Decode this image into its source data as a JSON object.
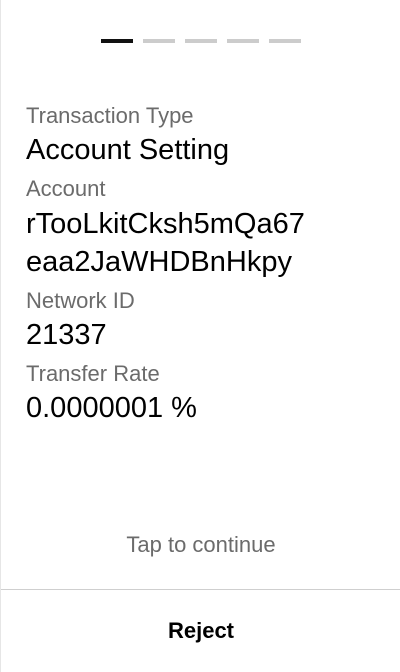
{
  "pager": {
    "total": 5,
    "current": 1
  },
  "fields": [
    {
      "label": "Transaction Type",
      "value": "Account Setting"
    },
    {
      "label": "Account",
      "value_lines": [
        "rTooLkitCksh5mQa67",
        "eaa2JaWHDBnHkpy"
      ]
    },
    {
      "label": "Network ID",
      "value": "21337"
    },
    {
      "label": "Transfer Rate",
      "value": "0.0000001 %"
    }
  ],
  "footer": {
    "hint": "Tap to continue",
    "reject_label": "Reject"
  },
  "colors": {
    "active_dot": "#111111",
    "inactive_dot": "#cccccc",
    "label_text": "#6b6b6b"
  }
}
